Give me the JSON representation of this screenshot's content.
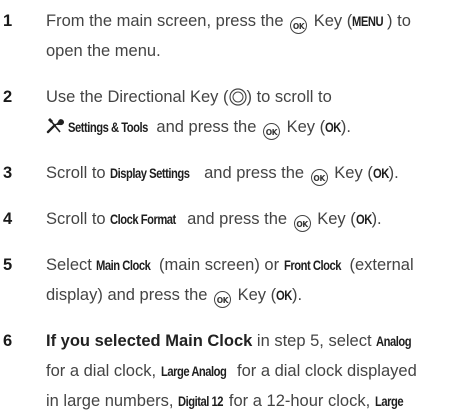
{
  "steps": [
    {
      "num": "1",
      "l1a": "From the main screen, press the",
      "l1b": "Key (",
      "l1ui": "MENU",
      "l1c": ") to",
      "l2": "open the menu."
    },
    {
      "num": "2",
      "l1a": "Use the Directional Key (",
      "l1b": ") to scroll to",
      "l2ui": "Settings & Tools",
      "l2a": "and press the",
      "l2b": "Key (",
      "l2ui2": "OK",
      "l2c": ")."
    },
    {
      "num": "3",
      "a": "Scroll to",
      "ui": "Display Settings",
      "b": "and press the",
      "c": "Key (",
      "ui2": "OK",
      "d": ")."
    },
    {
      "num": "4",
      "a": "Scroll to",
      "ui": "Clock Format",
      "b": "and press the",
      "c": "Key (",
      "ui2": "OK",
      "d": ")."
    },
    {
      "num": "5",
      "l1a": "Select",
      "l1ui": "Main Clock",
      "l1b": "(main screen) or",
      "l1ui2": "Front Clock",
      "l1c": "(external",
      "l2a": "display) and press the",
      "l2b": "Key (",
      "l2ui": "OK",
      "l2c": ")."
    },
    {
      "num": "6",
      "l1strong": "If you selected Main Clock",
      "l1a": "in step 5, select",
      "l1ui": "Analog",
      "l2a": "for a dial clock,",
      "l2ui": "Large Analog",
      "l2b": "for a dial clock displayed",
      "l3a": "in large numbers,",
      "l3ui": "Digital 12",
      "l3b": "for a 12-hour clock,",
      "l3ui2": "Large"
    }
  ],
  "icons": {
    "ok_key": "ok-key-icon",
    "ok_key_text": "OK",
    "directional_key": "directional-key-icon",
    "settings_tools": "settings-tools-icon"
  }
}
